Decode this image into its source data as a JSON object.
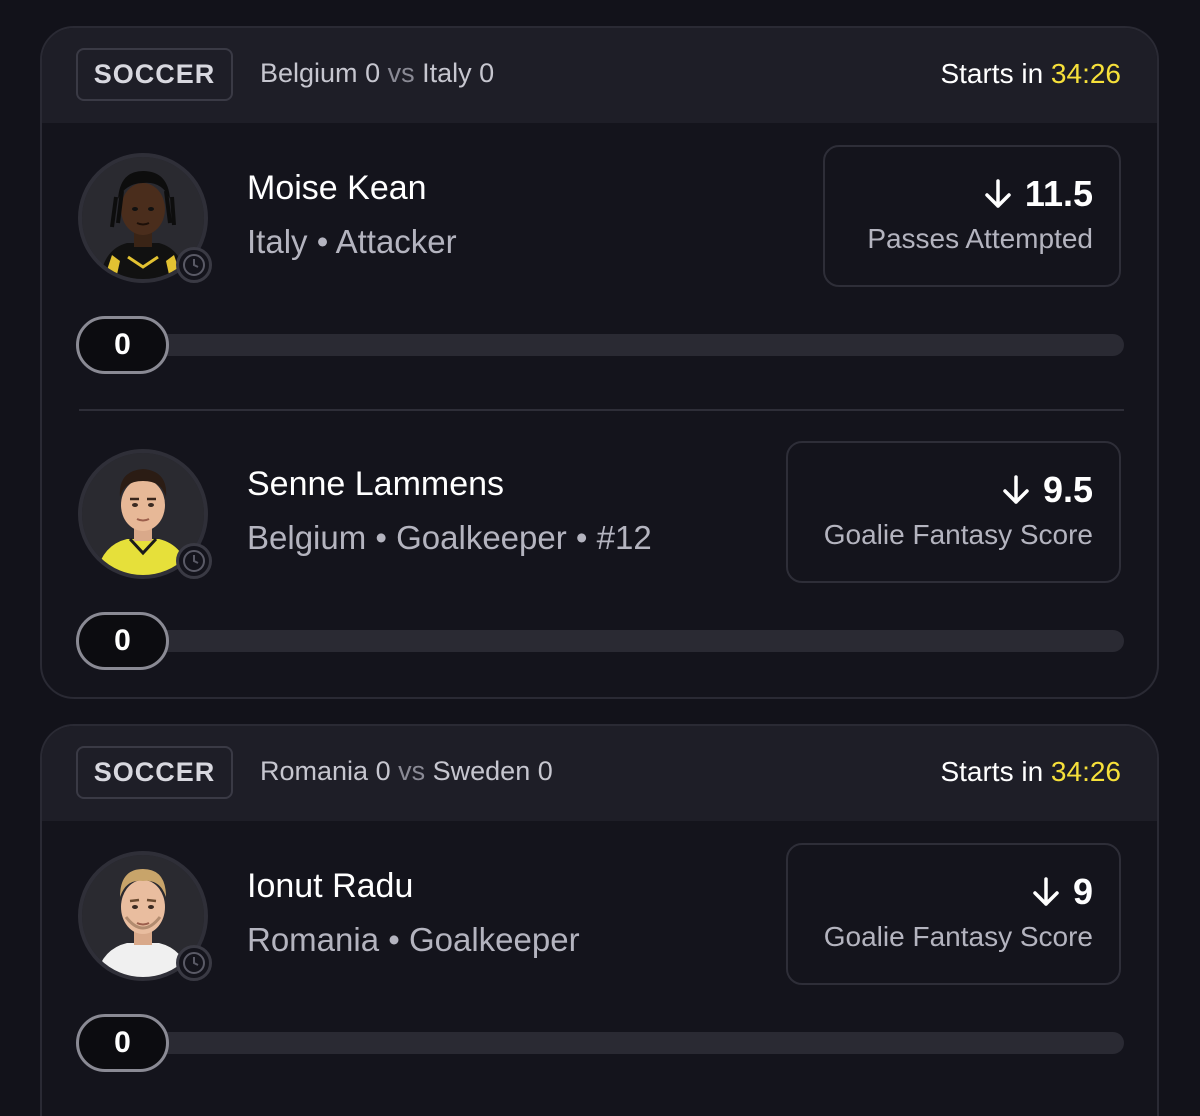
{
  "colors": {
    "background": "#12121a",
    "card": "#14141c",
    "card_header": "#1e1e27",
    "timer_accent": "#f6e03a",
    "track": "#2a2a33"
  },
  "games": [
    {
      "sport": "SOCCER",
      "team_a": "Belgium",
      "score_a": "0",
      "vs": "vs",
      "team_b": "Italy",
      "score_b": "0",
      "starts_label": "Starts in",
      "timer": "34:26",
      "picks": [
        {
          "name": "Moise Kean",
          "meta": "Italy • Attacker",
          "direction_icon": "arrow-down-icon",
          "line": "11.5",
          "stat": "Passes Attempted",
          "progress_value": "0",
          "progress_fraction": 0
        },
        {
          "name": "Senne Lammens",
          "meta": "Belgium • Goalkeeper • #12",
          "direction_icon": "arrow-down-icon",
          "line": "9.5",
          "stat": "Goalie Fantasy Score",
          "progress_value": "0",
          "progress_fraction": 0
        }
      ]
    },
    {
      "sport": "SOCCER",
      "team_a": "Romania",
      "score_a": "0",
      "vs": "vs",
      "team_b": "Sweden",
      "score_b": "0",
      "starts_label": "Starts in",
      "timer": "34:26",
      "picks": [
        {
          "name": "Ionut Radu",
          "meta": "Romania • Goalkeeper",
          "direction_icon": "arrow-down-icon",
          "line": "9",
          "stat": "Goalie Fantasy Score",
          "progress_value": "0",
          "progress_fraction": 0
        }
      ]
    }
  ]
}
